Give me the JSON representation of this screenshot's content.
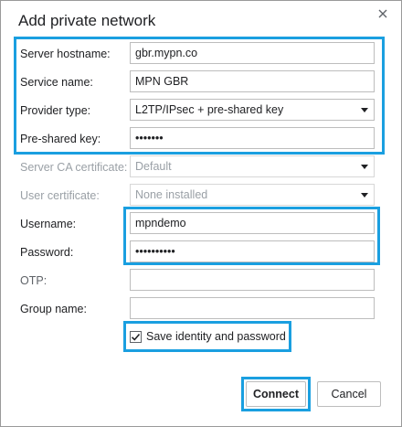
{
  "dialog": {
    "title": "Add private network",
    "close_icon": "close-icon"
  },
  "form": {
    "server_hostname": {
      "label": "Server hostname:",
      "value": "gbr.mypn.co"
    },
    "service_name": {
      "label": "Service name:",
      "value": "MPN GBR"
    },
    "provider_type": {
      "label": "Provider type:",
      "value": "L2TP/IPsec + pre-shared key"
    },
    "pre_shared_key": {
      "label": "Pre-shared key:",
      "value": "•••••••"
    },
    "server_ca_certificate": {
      "label": "Server CA certificate:",
      "value": "Default"
    },
    "user_certificate": {
      "label": "User certificate:",
      "value": "None installed"
    },
    "username": {
      "label": "Username:",
      "value": "mpndemo"
    },
    "password": {
      "label": "Password:",
      "value": "••••••••••"
    },
    "otp": {
      "label": "OTP:",
      "value": ""
    },
    "group_name": {
      "label": "Group name:",
      "value": ""
    },
    "save_identity": {
      "label": "Save identity and password",
      "checked": true
    }
  },
  "buttons": {
    "connect": "Connect",
    "cancel": "Cancel"
  },
  "colors": {
    "highlight": "#1a9fe0",
    "disabled_text": "#9aa0a6"
  }
}
